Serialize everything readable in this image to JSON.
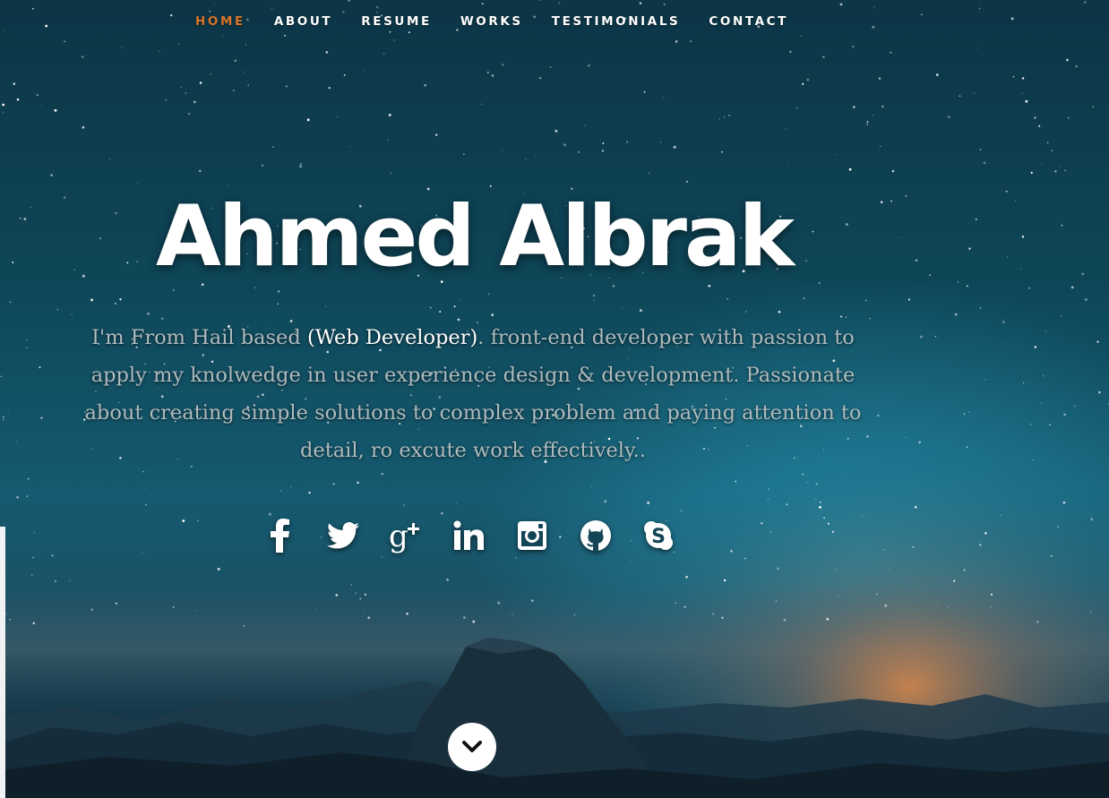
{
  "nav": {
    "items": [
      {
        "label": "HOME",
        "active": true
      },
      {
        "label": "ABOUT",
        "active": false
      },
      {
        "label": "RESUME",
        "active": false
      },
      {
        "label": "WORKS",
        "active": false
      },
      {
        "label": "TESTIMONIALS",
        "active": false
      },
      {
        "label": "CONTACT",
        "active": false
      }
    ],
    "active_color": "#d8742a"
  },
  "hero": {
    "title": "Ahmed Albrak",
    "intro_before": "I'm From Hail based ",
    "intro_highlight": "(Web Developer)",
    "intro_after": ". front-end developer with passion to apply my knolwedge in user experience design & development. Passionate about creating simple solutions to complex problem and paying attention to detail, ro excute work effectively.."
  },
  "social": [
    {
      "name": "facebook-icon"
    },
    {
      "name": "twitter-icon"
    },
    {
      "name": "google-plus-icon"
    },
    {
      "name": "linkedin-icon"
    },
    {
      "name": "instagram-icon"
    },
    {
      "name": "github-icon"
    },
    {
      "name": "skype-icon"
    }
  ],
  "scroll_button": {
    "icon": "chevron-down-icon"
  }
}
